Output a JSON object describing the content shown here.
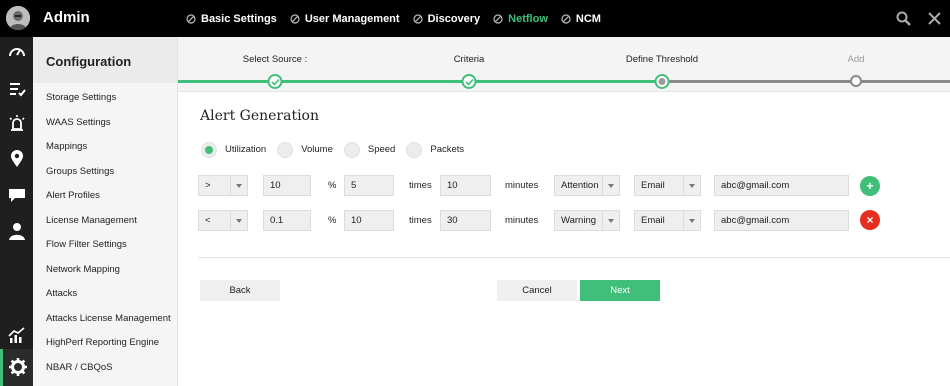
{
  "app": {
    "title": "Admin"
  },
  "topnav": {
    "items": [
      {
        "label": "Basic Settings",
        "active": false
      },
      {
        "label": "User Management",
        "active": false
      },
      {
        "label": "Discovery",
        "active": false
      },
      {
        "label": "Netflow",
        "active": true
      },
      {
        "label": "NCM",
        "active": false
      }
    ],
    "right_icons": [
      "search-icon",
      "tools-close-icon"
    ]
  },
  "rail": {
    "icons": [
      "dashboard-icon",
      "inventory-icon",
      "alarms-icon",
      "map-icon",
      "chat-icon",
      "user-icon",
      "reports-icon",
      "settings-icon"
    ],
    "active": "settings-icon"
  },
  "sidebar": {
    "heading": "Configuration",
    "items": [
      "Storage Settings",
      "WAAS Settings",
      "Mappings",
      "Groups Settings",
      "Alert Profiles",
      "License Management",
      "Flow Filter Settings",
      "Network Mapping",
      "Attacks",
      "Attacks License Management",
      "HighPerf Reporting Engine",
      "NBAR / CBQoS"
    ]
  },
  "stepper": {
    "steps": [
      {
        "label": "Select Source :",
        "state": "done"
      },
      {
        "label": "Criteria",
        "state": "done"
      },
      {
        "label": "Define Threshold",
        "state": "current"
      },
      {
        "label": "Add",
        "state": "todo"
      }
    ]
  },
  "alert": {
    "title": "Alert Generation",
    "metrics": [
      {
        "label": "Utilization",
        "selected": true
      },
      {
        "label": "Volume",
        "selected": false
      },
      {
        "label": "Speed",
        "selected": false
      },
      {
        "label": "Packets",
        "selected": false
      }
    ],
    "rules": [
      {
        "operator": ">",
        "value": "10",
        "percent_sign": "%",
        "threshold": "5",
        "times_label": "times",
        "minutes_value": "10",
        "minutes_label": "minutes",
        "severity": "Attention",
        "channel": "Email",
        "email": "abc@gmail.com",
        "action": "+"
      },
      {
        "operator": "<",
        "value": "0.1",
        "percent_sign": "%",
        "threshold": "10",
        "times_label": "times",
        "minutes_value": "30",
        "minutes_label": "minutes",
        "severity": "Warning",
        "channel": "Email",
        "email": "abc@gmail.com",
        "action": "×"
      }
    ]
  },
  "buttons": {
    "back": "Back",
    "cancel": "Cancel",
    "next": "Next"
  },
  "colors": {
    "accent": "#3fbf7a",
    "danger": "#e62e1e",
    "topbar": "#000000"
  }
}
